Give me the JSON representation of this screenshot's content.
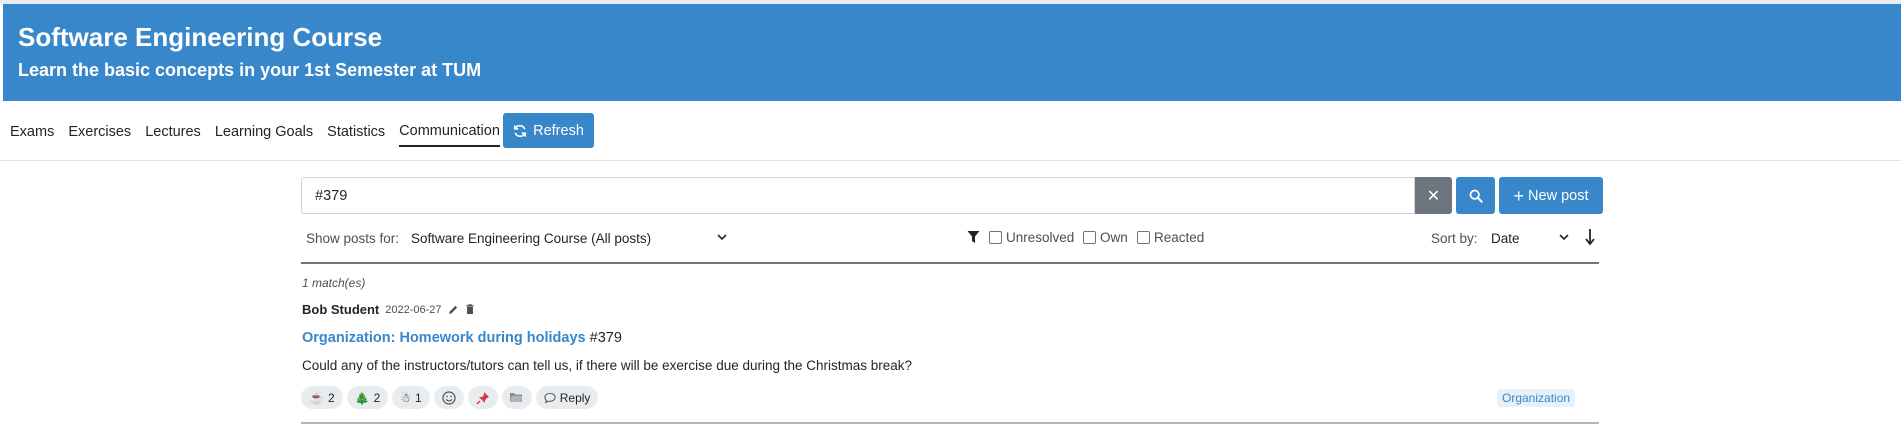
{
  "header": {
    "title": "Software Engineering Course",
    "subtitle": "Learn the basic concepts in your 1st Semester at TUM"
  },
  "nav": {
    "items": [
      {
        "label": "Exams",
        "active": false
      },
      {
        "label": "Exercises",
        "active": false
      },
      {
        "label": "Lectures",
        "active": false
      },
      {
        "label": "Learning Goals",
        "active": false
      },
      {
        "label": "Statistics",
        "active": false
      },
      {
        "label": "Communication",
        "active": true
      }
    ],
    "refresh_label": "Refresh"
  },
  "search": {
    "value": "#379",
    "clear_icon": "close-icon",
    "search_icon": "search-icon",
    "new_post_label": "New post"
  },
  "filters": {
    "show_posts_label": "Show posts for:",
    "course_selected": "Software Engineering Course (All posts)",
    "unresolved_label": "Unresolved",
    "own_label": "Own",
    "reacted_label": "Reacted",
    "sort_label": "Sort by:",
    "sort_value": "Date"
  },
  "results": {
    "match_text": "1 match(es)"
  },
  "post": {
    "author": "Bob Student",
    "date": "2022-06-27",
    "title": "Organization: Homework during holidays",
    "number": "#379",
    "body": "Could any of the instructors/tutors can tell us, if there will be exercise due during the Christmas break?",
    "reactions": [
      {
        "emoji": "☕",
        "count": "2"
      },
      {
        "emoji": "🎄",
        "count": "2"
      },
      {
        "emoji": "☃",
        "count": "1"
      }
    ],
    "reply_label": "Reply",
    "tag": "Organization"
  },
  "colors": {
    "primary": "#3787ca",
    "secondary": "#6c757d"
  }
}
